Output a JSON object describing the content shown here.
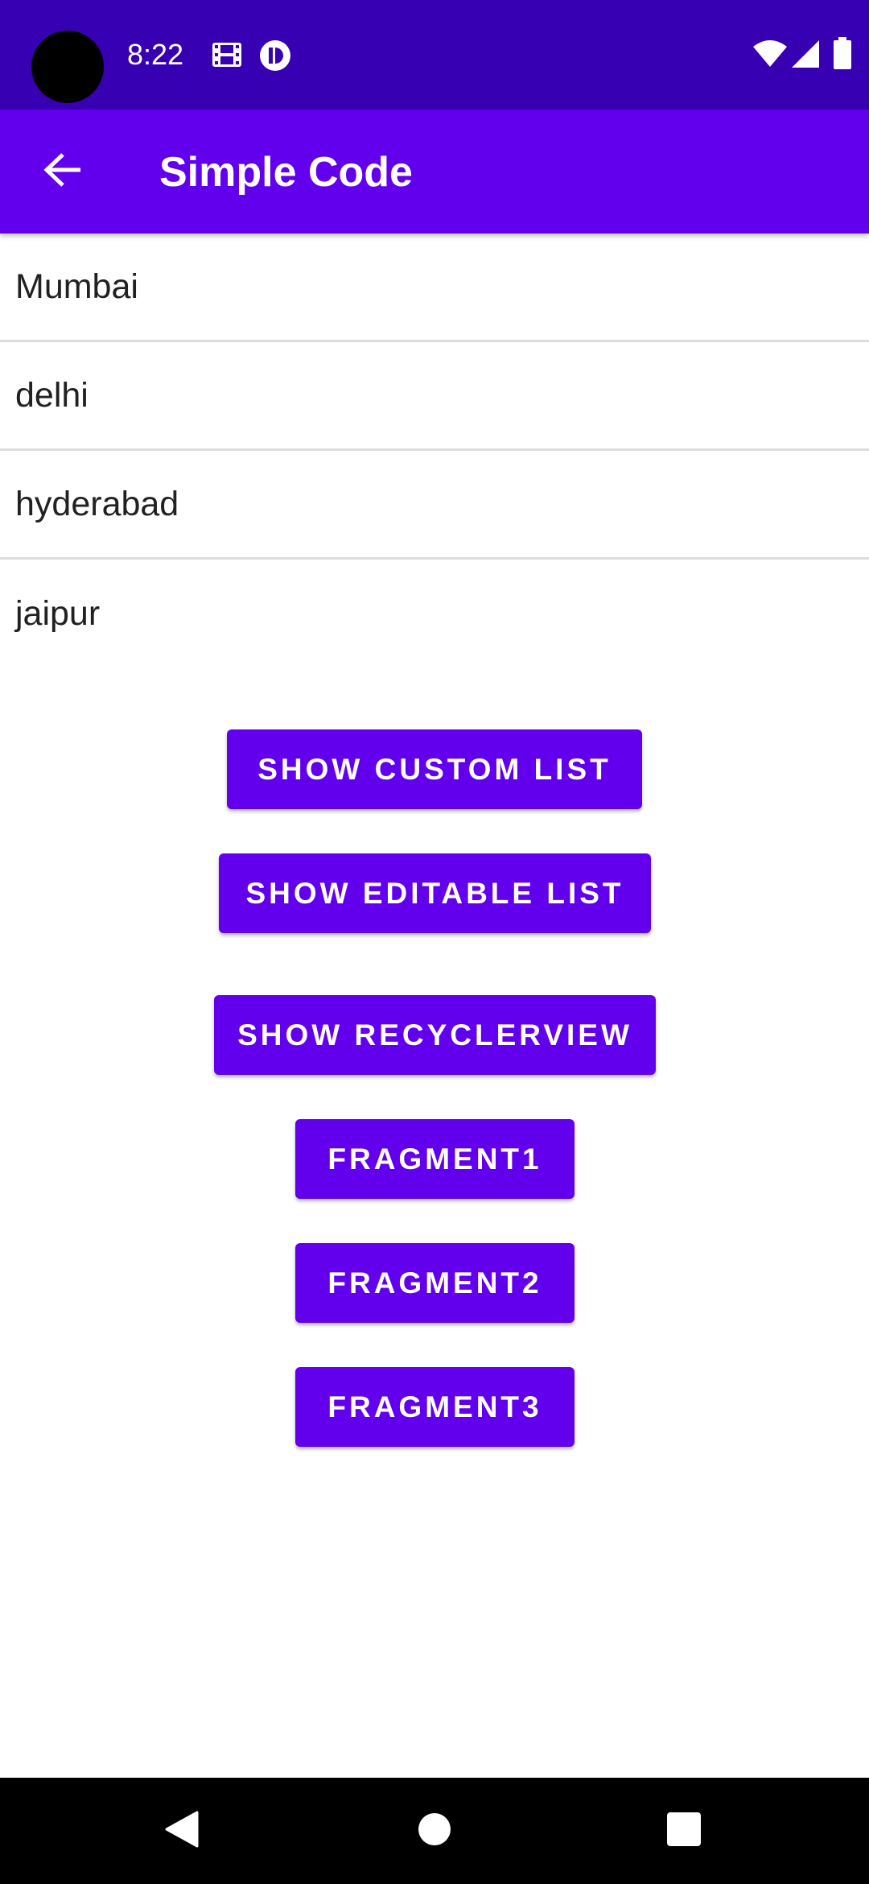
{
  "status_bar": {
    "time": "8:22",
    "icons": [
      "film-icon",
      "data-saver-icon",
      "wifi-icon",
      "signal-icon",
      "battery-icon"
    ],
    "background": "#3700b3"
  },
  "app_bar": {
    "title": "Simple Code",
    "back_icon": "arrow-back-icon",
    "background": "#6200ee"
  },
  "list": {
    "items": [
      {
        "label": "Mumbai"
      },
      {
        "label": "delhi"
      },
      {
        "label": "hyderabad"
      },
      {
        "label": "jaipur"
      }
    ]
  },
  "buttons": {
    "show_custom_list": "SHOW CUSTOM LIST",
    "show_editable_list": "SHOW EDITABLE LIST",
    "show_recyclerview": "SHOW RECYCLERVIEW",
    "fragment1": "FRAGMENT1",
    "fragment2": "FRAGMENT2",
    "fragment3": "FRAGMENT3",
    "color": "#6200ee"
  },
  "nav_bar": {
    "icons": [
      "nav-back-icon",
      "nav-home-icon",
      "nav-recents-icon"
    ]
  }
}
